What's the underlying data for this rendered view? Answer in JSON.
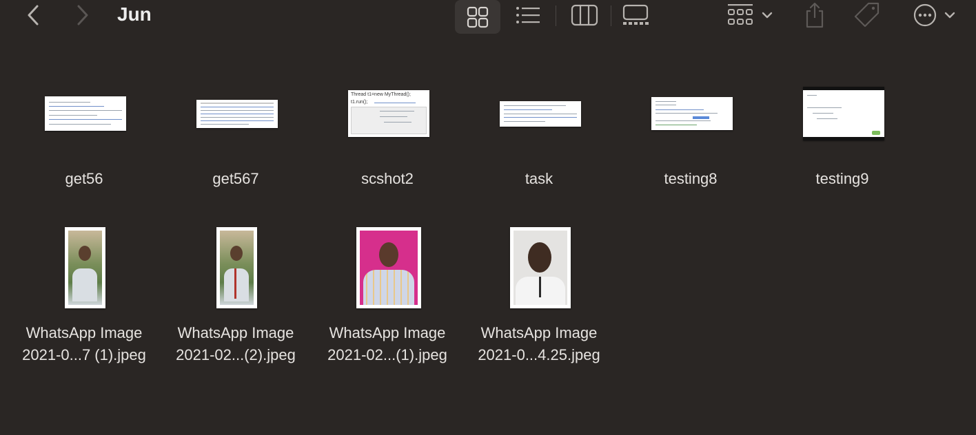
{
  "toolbar": {
    "title": "Jun",
    "icons": {
      "back": "chevron-left-icon",
      "forward": "chevron-right-icon",
      "grid": "grid-view-icon",
      "list": "list-view-icon",
      "columns": "column-view-icon",
      "gallery": "gallery-view-icon",
      "group": "group-icon",
      "share": "share-icon",
      "tag": "tag-icon",
      "more": "more-icon"
    }
  },
  "files": [
    {
      "line1": "get56",
      "line2": ""
    },
    {
      "line1": "get567",
      "line2": ""
    },
    {
      "line1": "scshot2",
      "line2": ""
    },
    {
      "line1": "task",
      "line2": ""
    },
    {
      "line1": "testing8",
      "line2": ""
    },
    {
      "line1": "testing9",
      "line2": ""
    },
    {
      "line1": "WhatsApp Image",
      "line2": "2021-0...7 (1).jpeg"
    },
    {
      "line1": "WhatsApp Image",
      "line2": "2021-02...(2).jpeg"
    },
    {
      "line1": "WhatsApp Image",
      "line2": "2021-02...(1).jpeg"
    },
    {
      "line1": "WhatsApp Image",
      "line2": "2021-0...4.25.jpeg"
    }
  ],
  "thumb_text": {
    "scshot2_line1": "Thread t1=new MyThread();",
    "scshot2_line2": "t1.run();"
  },
  "colors": {
    "background": "#2a2624",
    "text": "#e6e3e0",
    "selected_view_bg": "#3a3634"
  }
}
